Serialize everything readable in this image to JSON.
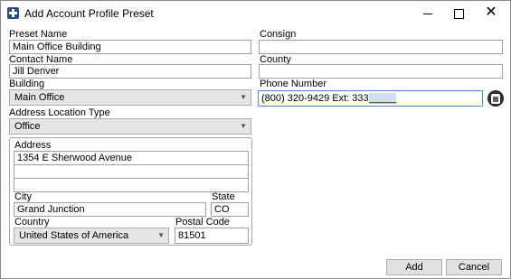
{
  "window": {
    "title": "Add Account Profile Preset",
    "minimize_glyph": "",
    "maximize_glyph": "",
    "close_glyph": "✕"
  },
  "form": {
    "preset_name": {
      "label": "Preset Name",
      "value": "Main Office Building"
    },
    "contact_name": {
      "label": "Contact Name",
      "value": "Jill Denver"
    },
    "building": {
      "label": "Building",
      "value": "Main Office"
    },
    "address_location_type": {
      "label": "Address Location Type",
      "value": "Office"
    },
    "address": {
      "label": "Address",
      "line1": "1354 E Sherwood Avenue",
      "line2": "",
      "line3": ""
    },
    "city": {
      "label": "City",
      "value": "Grand Junction"
    },
    "state": {
      "label": "State",
      "value": "CO"
    },
    "country": {
      "label": "Country",
      "value": "United States of America"
    },
    "postal_code": {
      "label": "Postal Code",
      "value": "81501"
    },
    "consign": {
      "label": "Consign",
      "value": ""
    },
    "county": {
      "label": "County",
      "value": ""
    },
    "phone_number": {
      "label": "Phone Number",
      "value_main": "(800) 320-9429 Ext: 333",
      "value_mask": "_____"
    }
  },
  "buttons": {
    "add": "Add",
    "cancel": "Cancel"
  },
  "icons": {
    "app": "app-icon",
    "phone": "phone-icon",
    "dropdown": "chevron-down-icon"
  },
  "colors": {
    "focus_border": "#4a90d9",
    "button_bg": "#e1e1e1",
    "combo_bg": "#e5e5e5"
  }
}
